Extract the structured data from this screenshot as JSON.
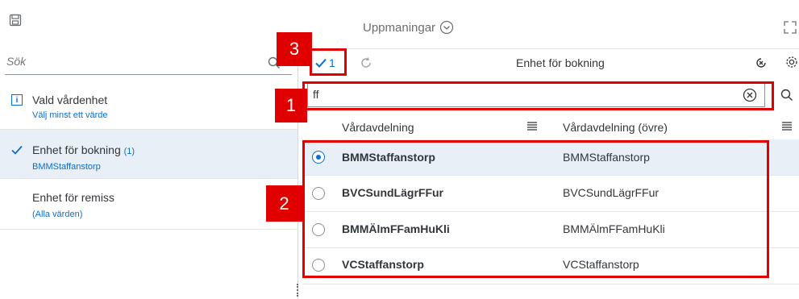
{
  "toolbar": {
    "title": "Uppmaningar",
    "icons": [
      "save-icon",
      "chevron-down-icon",
      "fullscreen-icon"
    ]
  },
  "left_panel": {
    "search_placeholder": "Sök",
    "filters": [
      {
        "name": "Vald vårdenhet",
        "sub": "Välj minst ett värde",
        "info": "i"
      },
      {
        "name": "Enhet för bokning",
        "count": "(1)",
        "sub": "BMMStaffanstorp",
        "selected": true
      },
      {
        "name": "Enhet för remiss",
        "sub": "(Alla värden)"
      }
    ]
  },
  "value_panel": {
    "selected_count": "1",
    "title": "Enhet för bokning",
    "search_value": "ff",
    "columns": [
      "Vårdavdelning",
      "Vårdavdelning (övre)"
    ],
    "rows": [
      {
        "col1": "BMMStaffanstorp",
        "col2": "BMMStaffanstorp",
        "selected": true
      },
      {
        "col1": "BVCSundLägrFFur",
        "col2": "BVCSundLägrFFur",
        "selected": false
      },
      {
        "col1": "BMMÄlmFFamHuKli",
        "col2": "BMMÄlmFFamHuKli",
        "selected": false
      },
      {
        "col1": "VCStaffanstorp",
        "col2": "VCStaffanstorp",
        "selected": false
      }
    ]
  },
  "annotations": {
    "labels": [
      "1",
      "2",
      "3"
    ],
    "color": "#e00000"
  },
  "colors": {
    "accent": "#0a6ed1",
    "selected_row": "#e8eff6",
    "annotation": "#e00000"
  }
}
